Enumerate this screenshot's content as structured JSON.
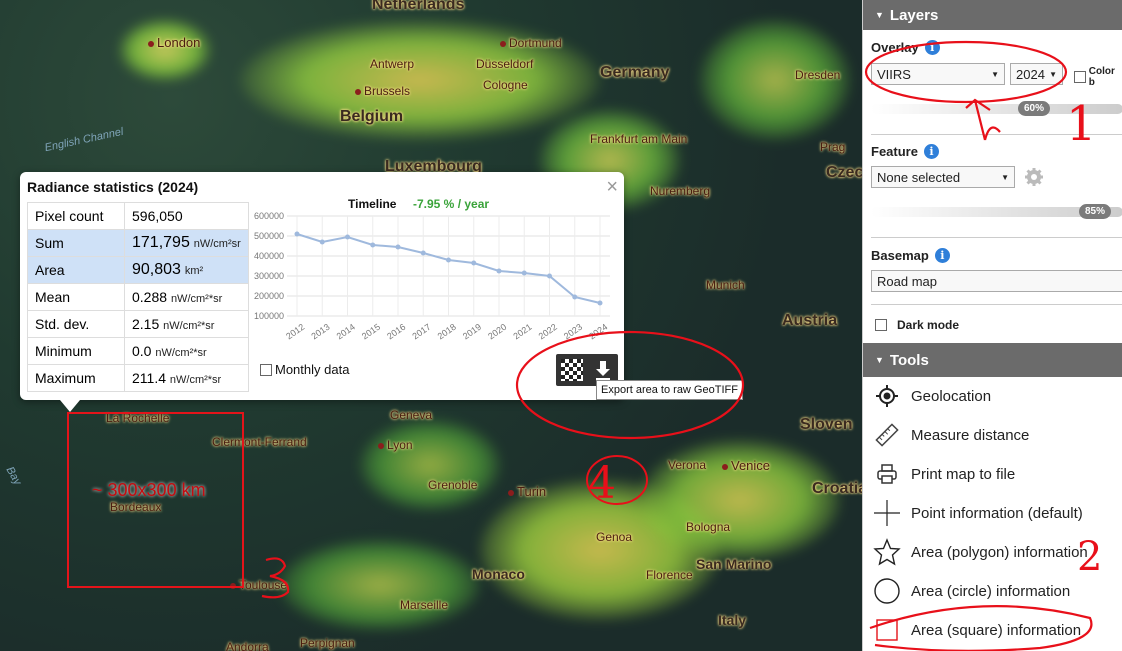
{
  "map": {
    "countries": [
      "Netherlands",
      "Germany",
      "Belgium",
      "Luxembourg",
      "Czec",
      "Austria",
      "Sloven",
      "Croatia"
    ],
    "cities": [
      "London",
      "Dortmund",
      "Antwerp",
      "Düsseldorf",
      "Brussels",
      "Cologne",
      "Dresden",
      "Frankfurt am Main",
      "Prag",
      "Nuremberg",
      "Munich",
      "La Rochelle",
      "Clermont-Ferrand",
      "Lyon",
      "Geneva",
      "Grenoble",
      "Turin",
      "Genoa",
      "Verona",
      "Venice",
      "Bologna",
      "Florence",
      "Bordeaux",
      "Toulouse",
      "Marseille",
      "Monaco",
      "Perpignan",
      "San Marino",
      "Italy",
      "Andorra"
    ],
    "seas": [
      "English Channel",
      "Bay"
    ],
    "square_label": "~ 300x300 km"
  },
  "popup": {
    "title": "Radiance statistics (2024)",
    "close_icon": "close-icon",
    "stats": [
      {
        "label": "Pixel count",
        "value": "596,050",
        "unit": ""
      },
      {
        "label": "Sum",
        "value": "171,795",
        "unit": "nW/cm²sr"
      },
      {
        "label": "Area",
        "value": "90,803",
        "unit": "km²"
      },
      {
        "label": "Mean",
        "value": "0.288",
        "unit": "nW/cm²*sr"
      },
      {
        "label": "Std. dev.",
        "value": "2.15",
        "unit": "nW/cm²*sr"
      },
      {
        "label": "Minimum",
        "value": "0.0",
        "unit": "nW/cm²*sr"
      },
      {
        "label": "Maximum",
        "value": "211.4",
        "unit": "nW/cm²*sr"
      }
    ],
    "timeline_label": "Timeline",
    "trend": "-7.95 % / year",
    "trend_color": "#3aa33a",
    "monthly_label": "Monthly data",
    "export_tooltip": "Export area to raw GeoTIFF",
    "export_icons": [
      "checkerboard-icon",
      "download-icon"
    ]
  },
  "chart_data": {
    "type": "line",
    "x": [
      "2012",
      "2013",
      "2014",
      "2015",
      "2016",
      "2017",
      "2018",
      "2019",
      "2020",
      "2021",
      "2022",
      "2023",
      "2024"
    ],
    "values": [
      510000,
      470000,
      495000,
      455000,
      445000,
      415000,
      380000,
      365000,
      325000,
      315000,
      300000,
      195000,
      165000
    ],
    "yticks": [
      "600000",
      "500000",
      "400000",
      "300000",
      "200000",
      "100000"
    ],
    "ylim": [
      100000,
      600000
    ],
    "line_color": "#9fb9dd",
    "grid": true
  },
  "panel": {
    "layers_title": "Layers",
    "overlay_label": "Overlay",
    "overlay_value": "VIIRS",
    "year_value": "2024",
    "color_label": "Color b",
    "overlay_opacity": "60%",
    "feature_label": "Feature",
    "feature_value": "None selected",
    "feature_opacity": "85%",
    "basemap_label": "Basemap",
    "basemap_value": "Road map",
    "dark_mode_label": "Dark mode",
    "tools_title": "Tools",
    "tools": [
      {
        "label": "Geolocation",
        "icon": "crosshair-icon"
      },
      {
        "label": "Measure distance",
        "icon": "ruler-icon"
      },
      {
        "label": "Print map to file",
        "icon": "printer-icon"
      },
      {
        "label": "Point information (default)",
        "icon": "plus-icon"
      },
      {
        "label": "Area (polygon) information",
        "icon": "star-icon"
      },
      {
        "label": "Area (circle) information",
        "icon": "circle-icon"
      },
      {
        "label": "Area (square) information",
        "icon": "square-icon"
      }
    ]
  },
  "annotations": [
    "1",
    "2",
    "3",
    "4"
  ]
}
